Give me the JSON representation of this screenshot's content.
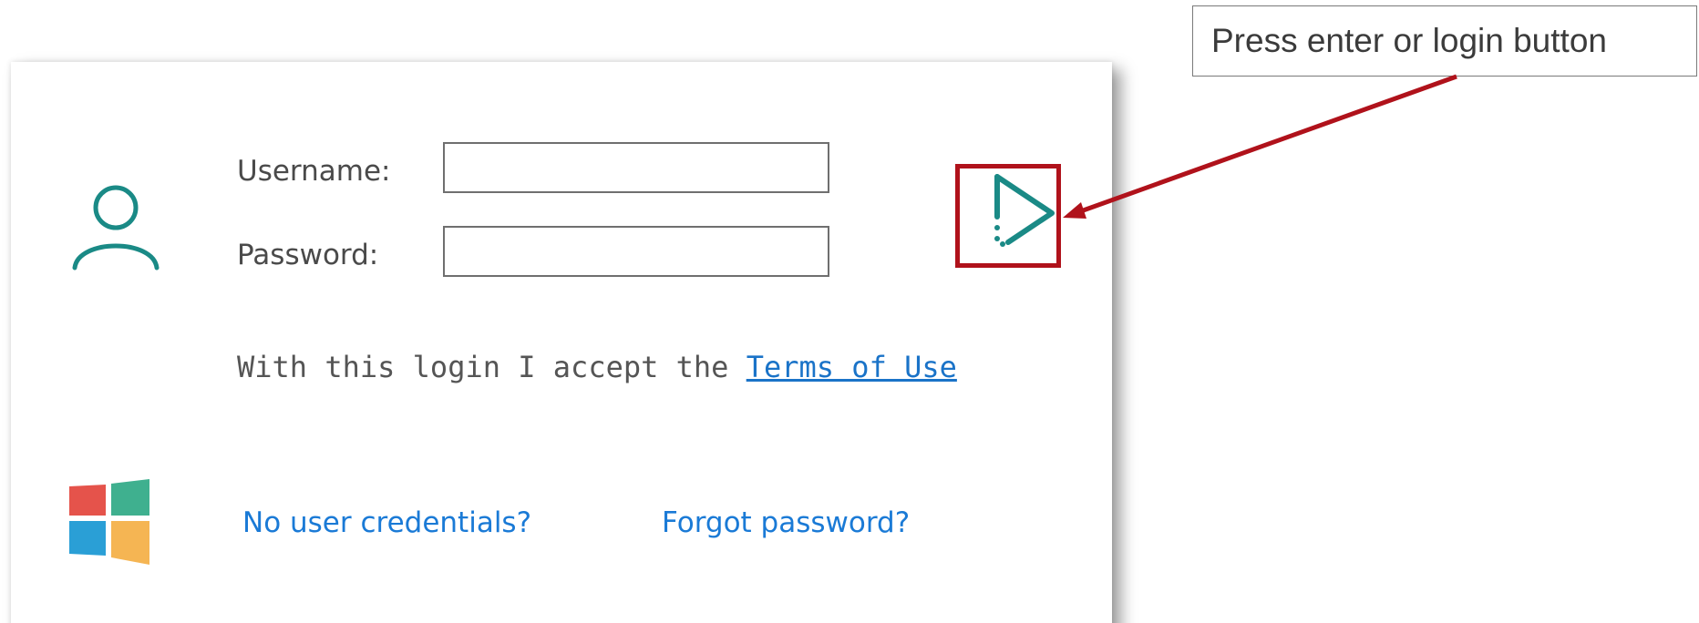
{
  "login_form": {
    "username_label": "Username:",
    "username_value": "",
    "password_label": "Password:",
    "password_value": "",
    "accept_text": "With this login I accept the ",
    "terms_link": "Terms of Use",
    "no_credentials_link": "No user credentials?",
    "forgot_password_link": "Forgot password?"
  },
  "annotation": {
    "callout_text": "Press enter or login button"
  },
  "icons": {
    "user": "user-icon",
    "login": "play-triangle-icon",
    "windows": "windows-logo-icon"
  },
  "colors": {
    "accent": "#1a8a86",
    "link": "#1a73c8",
    "annotation": "#b0121b",
    "windows_red": "#e5534b",
    "windows_green": "#3fb08f",
    "windows_blue": "#2a9fd6",
    "windows_orange": "#f5b553"
  }
}
